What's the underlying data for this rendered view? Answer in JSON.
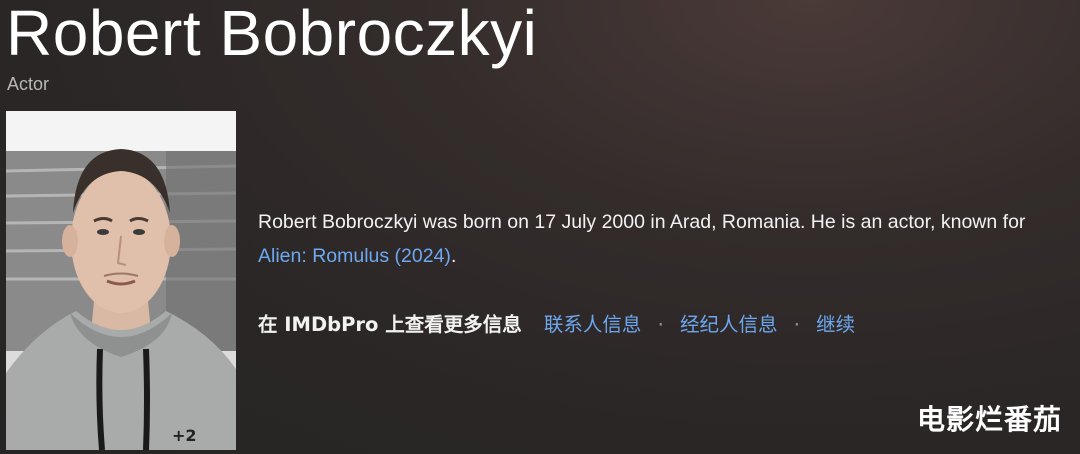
{
  "person": {
    "name": "Robert Bobroczkyi",
    "role": "Actor"
  },
  "bio": {
    "text_before": "Robert Bobroczkyi was born on 17 July 2000 in Arad, Romania. He is an actor, known for ",
    "link_text": "Alien: Romulus (2024)",
    "text_after": "."
  },
  "imdbpro": {
    "lead": "在 IMDbPro 上查看更多信息",
    "links": [
      "联系人信息",
      "经纪人信息",
      "继续"
    ],
    "separator": "·"
  },
  "watermark": "电影烂番茄",
  "colors": {
    "link": "#6ea8f0",
    "background": "#2a2626"
  }
}
